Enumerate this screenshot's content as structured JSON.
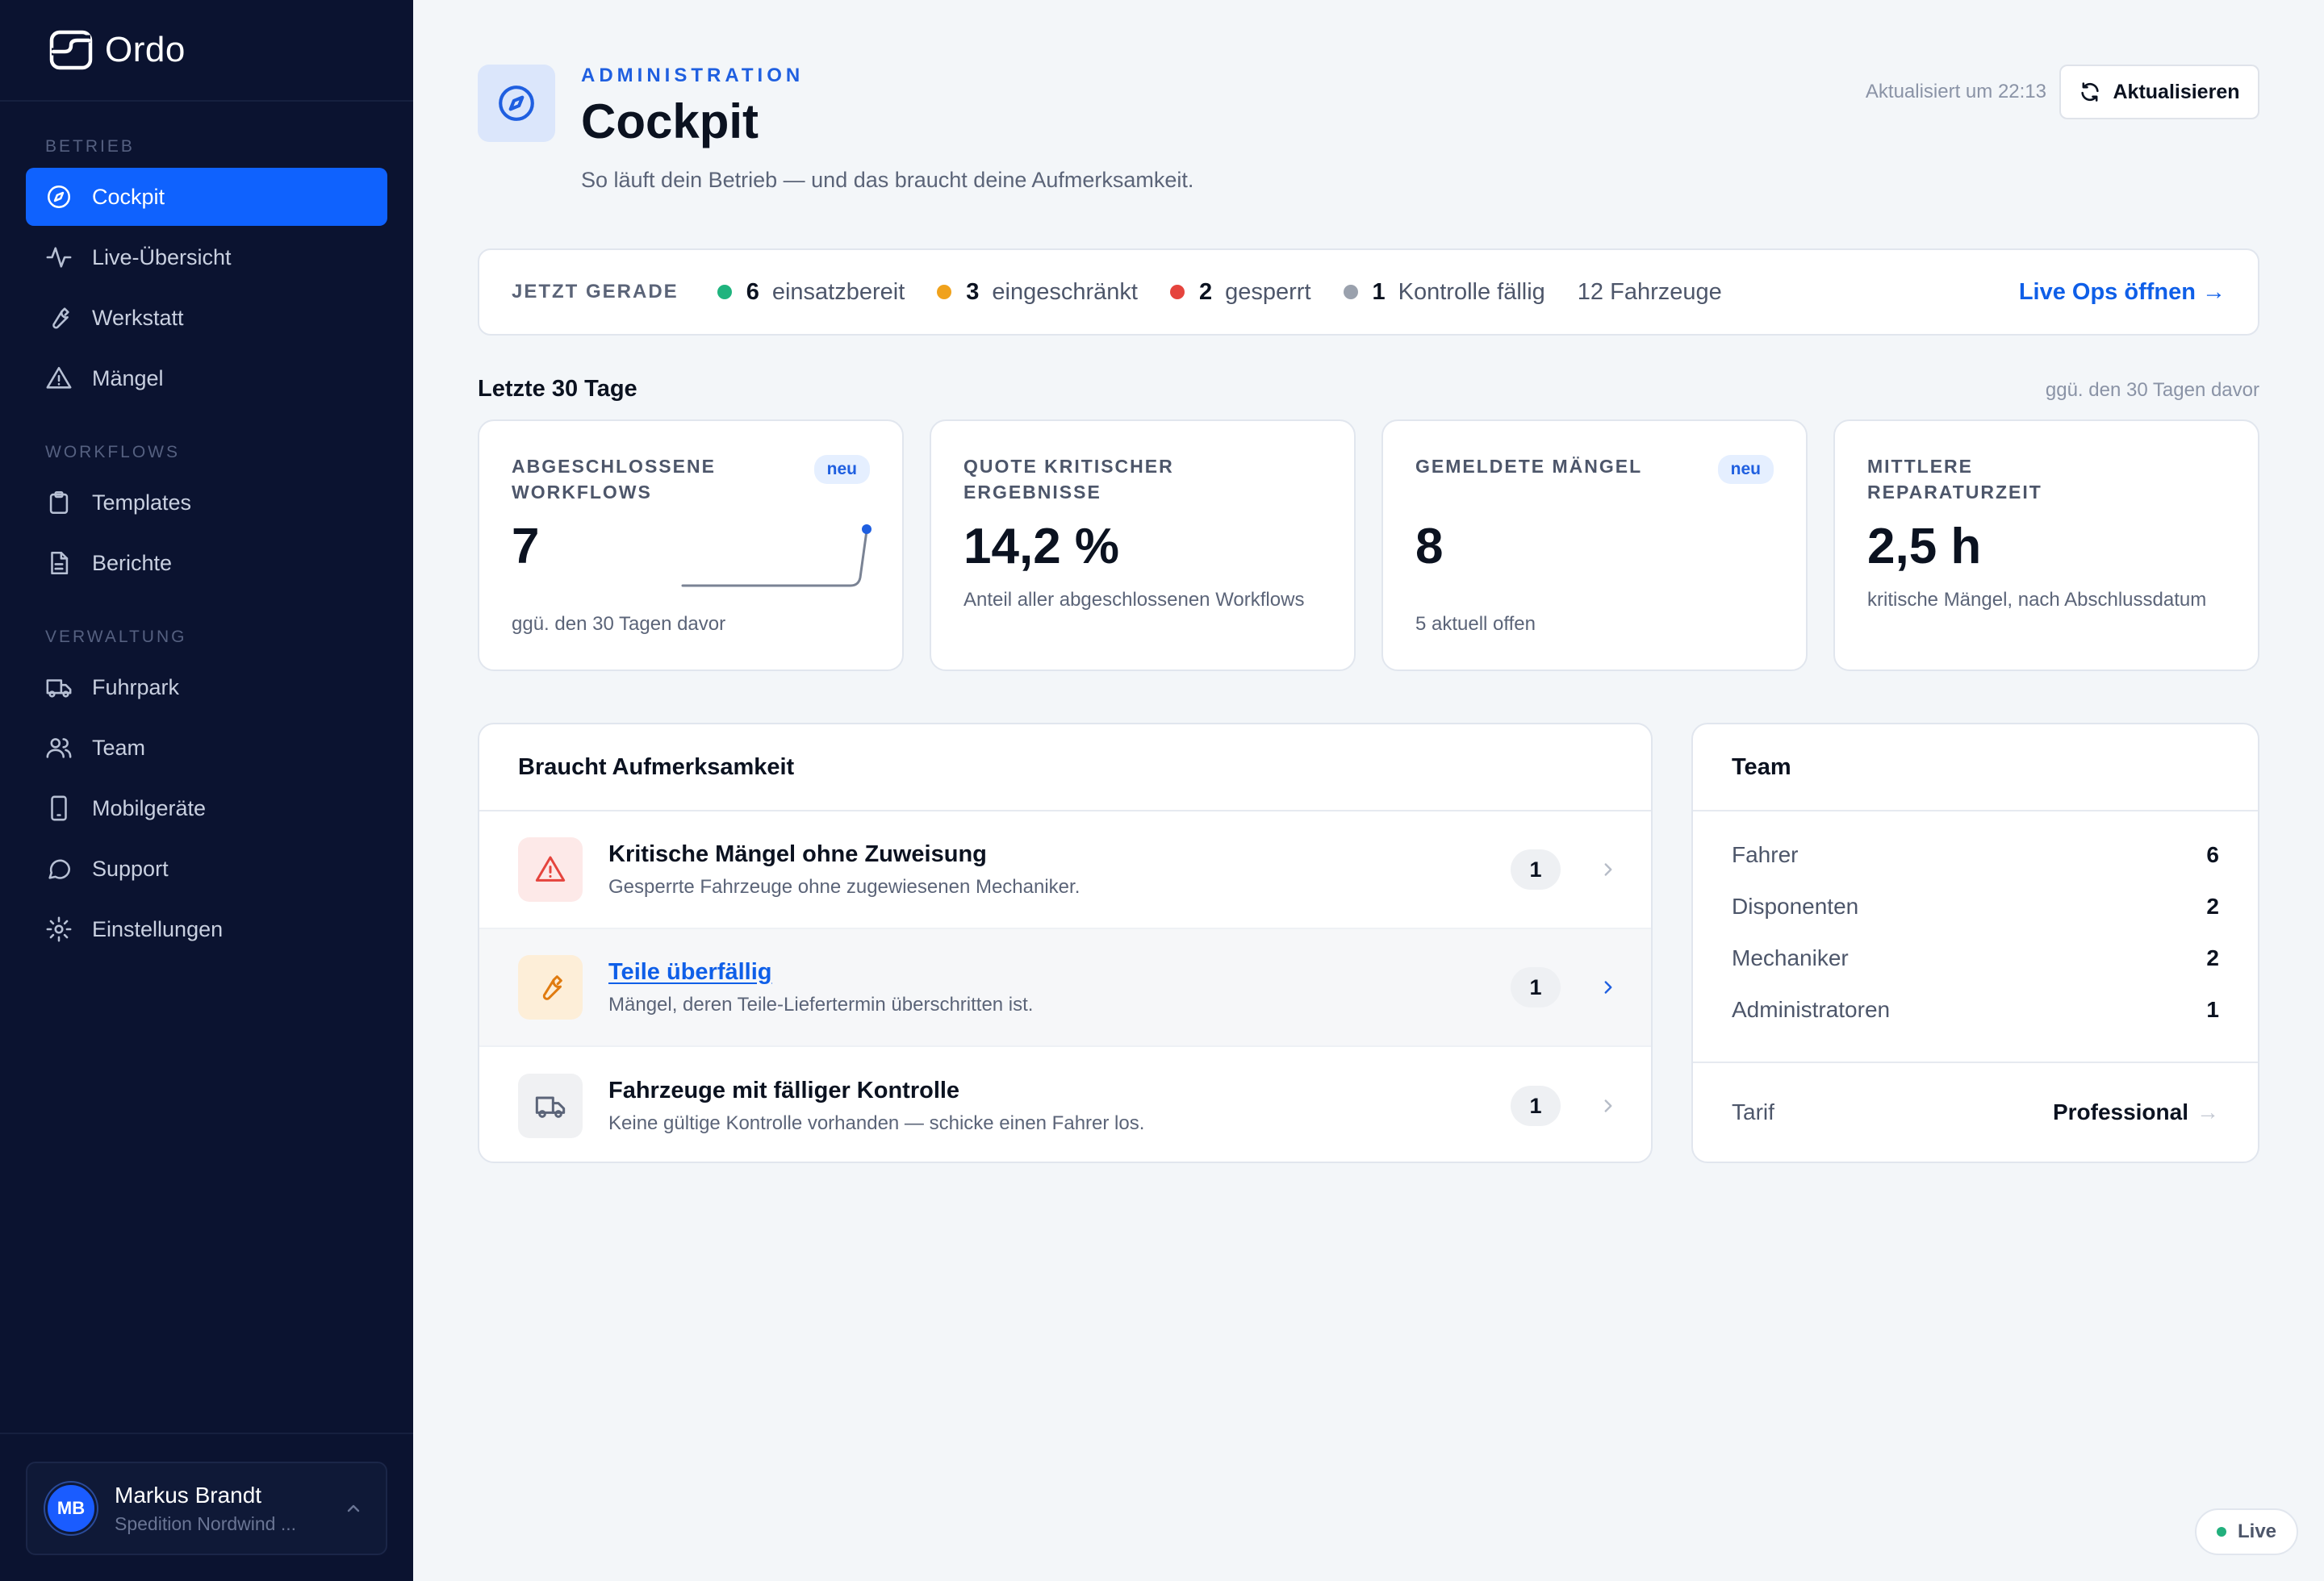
{
  "app": {
    "name": "Ordo"
  },
  "sidebar": {
    "sections": [
      {
        "label": "BETRIEB",
        "items": [
          {
            "id": "cockpit",
            "label": "Cockpit",
            "icon": "compass-icon",
            "active": true
          },
          {
            "id": "live",
            "label": "Live-Übersicht",
            "icon": "activity-icon"
          },
          {
            "id": "werkstatt",
            "label": "Werkstatt",
            "icon": "wrench-icon"
          },
          {
            "id": "maengel",
            "label": "Mängel",
            "icon": "warning-icon"
          }
        ]
      },
      {
        "label": "WORKFLOWS",
        "items": [
          {
            "id": "templates",
            "label": "Templates",
            "icon": "clipboard-icon"
          },
          {
            "id": "berichte",
            "label": "Berichte",
            "icon": "document-icon"
          }
        ]
      },
      {
        "label": "VERWALTUNG",
        "items": [
          {
            "id": "fuhrpark",
            "label": "Fuhrpark",
            "icon": "truck-icon"
          },
          {
            "id": "team",
            "label": "Team",
            "icon": "users-icon"
          },
          {
            "id": "mobil",
            "label": "Mobilgeräte",
            "icon": "phone-icon"
          },
          {
            "id": "support",
            "label": "Support",
            "icon": "chat-icon"
          },
          {
            "id": "einstellungen",
            "label": "Einstellungen",
            "icon": "gear-icon"
          }
        ]
      }
    ],
    "user": {
      "initials": "MB",
      "name": "Markus Brandt",
      "org": "Spedition Nordwind ..."
    }
  },
  "header": {
    "eyebrow": "ADMINISTRATION",
    "title": "Cockpit",
    "subtitle": "So läuft dein Betrieb — und das braucht deine Aufmerksamkeit.",
    "updated": "Aktualisiert um 22:13",
    "refresh_label": "Aktualisieren"
  },
  "status": {
    "label": "JETZT GERADE",
    "items": [
      {
        "count": "6",
        "text": "einsatzbereit",
        "color": "#1fb47e"
      },
      {
        "count": "3",
        "text": "eingeschränkt",
        "color": "#f0a21c"
      },
      {
        "count": "2",
        "text": "gesperrt",
        "color": "#e5443d"
      },
      {
        "count": "1",
        "text": "Kontrolle fällig",
        "color": "#9aa1ad"
      }
    ],
    "total": "12 Fahrzeuge",
    "link": "Live Ops öffnen →"
  },
  "period": {
    "title": "Letzte 30 Tage",
    "note": "ggü. den 30 Tagen davor"
  },
  "kpis": [
    {
      "label": "ABGESCHLOSSENE WORKFLOWS",
      "badge": "neu",
      "value": "7",
      "note": "ggü. den 30 Tagen davor",
      "spark": true
    },
    {
      "label": "QUOTE KRITISCHER ERGEBNISSE",
      "badge": "",
      "value": "14,2 %",
      "note": "Anteil aller abgeschlossenen Workflows"
    },
    {
      "label": "GEMELDETE MÄNGEL",
      "badge": "neu",
      "value": "8",
      "note": "5 aktuell offen"
    },
    {
      "label": "MITTLERE REPARATURZEIT",
      "badge": "",
      "value": "2,5 h",
      "note": "kritische Mängel, nach Abschlussdatum"
    }
  ],
  "attention": {
    "title": "Braucht Aufmerksamkeit",
    "rows": [
      {
        "title": "Kritische Mängel ohne Zuweisung",
        "desc": "Gesperrte Fahrzeuge ohne zugewiesenen Mechaniker.",
        "count": "1",
        "icon": "warning-icon",
        "tint": "#fde9e8",
        "color": "#e5443d"
      },
      {
        "title": "Teile überfällig",
        "desc": "Mängel, deren Teile-Liefertermin überschritten ist.",
        "count": "1",
        "icon": "wrench-icon",
        "tint": "#fdeed8",
        "color": "#e07b10",
        "highlight": true
      },
      {
        "title": "Fahrzeuge mit fälliger Kontrolle",
        "desc": "Keine gültige Kontrolle vorhanden — schicke einen Fahrer los.",
        "count": "1",
        "icon": "truck-icon",
        "tint": "#f0f1f3",
        "color": "#5b6478"
      }
    ]
  },
  "team": {
    "title": "Team",
    "rows": [
      {
        "label": "Fahrer",
        "value": "6"
      },
      {
        "label": "Disponenten",
        "value": "2"
      },
      {
        "label": "Mechaniker",
        "value": "2"
      },
      {
        "label": "Administratoren",
        "value": "1"
      }
    ],
    "plan_label": "Tarif",
    "plan_value": "Professional",
    "plan_arrow": "→"
  },
  "live_badge": "Live"
}
